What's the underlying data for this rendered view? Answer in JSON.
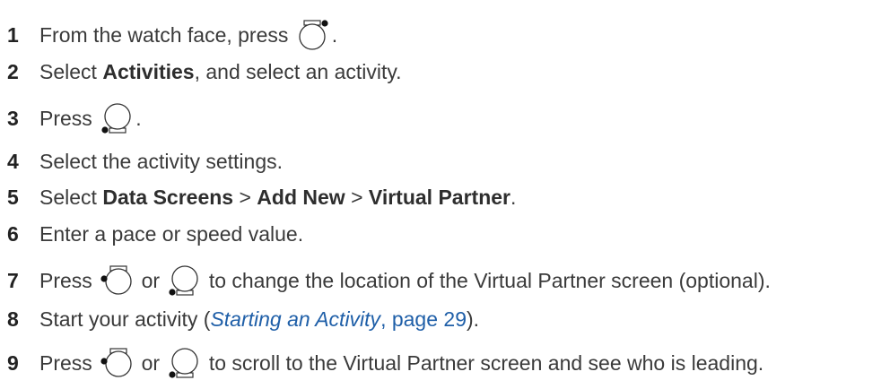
{
  "steps": [
    {
      "num": "1",
      "pre": "From the watch face, press",
      "post": "."
    },
    {
      "num": "2",
      "pre": "Select ",
      "bold1": "Activities",
      "post": ", and select an activity."
    },
    {
      "num": "3",
      "pre": "Press",
      "post": "."
    },
    {
      "num": "4",
      "text": "Select the activity settings."
    },
    {
      "num": "5",
      "pre": "Select ",
      "bold1": "Data Screens",
      "sep1": " > ",
      "bold2": "Add New",
      "sep2": " > ",
      "bold3": "Virtual Partner",
      "post": "."
    },
    {
      "num": "6",
      "text": "Enter a pace or speed value."
    },
    {
      "num": "7",
      "pre": "Press",
      "mid": "or",
      "post": "to change the location of the Virtual Partner screen (optional)."
    },
    {
      "num": "8",
      "pre": "Start your activity (",
      "link_text": "Starting an Activity",
      "link_page": ", page 29",
      "post": ")."
    },
    {
      "num": "9",
      "pre": "Press",
      "mid": "or",
      "post": "to scroll to the Virtual Partner screen and see who is leading."
    }
  ],
  "icons": {
    "step1": "watch-button-top-right-icon",
    "step3": "watch-button-bottom-left-icon",
    "step7_a": "watch-button-middle-left-icon",
    "step7_b": "watch-button-bottom-left-icon",
    "step9_a": "watch-button-middle-left-icon",
    "step9_b": "watch-button-bottom-left-icon"
  },
  "colors": {
    "text": "#3a3a3a",
    "link": "#1f5fa8"
  }
}
